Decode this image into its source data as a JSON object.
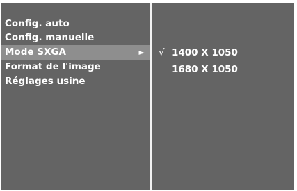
{
  "menu": {
    "items": [
      {
        "label": "Config. auto"
      },
      {
        "label": "Config. manuelle"
      },
      {
        "label": "Mode SXGA",
        "arrow": "►"
      },
      {
        "label": "Format de l'image"
      },
      {
        "label": "Réglages usine"
      }
    ]
  },
  "submenu": {
    "check_mark": "√",
    "options": [
      {
        "label": "1400 X 1050",
        "checked": true
      },
      {
        "label": "1680 X 1050",
        "checked": false
      }
    ]
  },
  "colors": {
    "panel_bg": "#646464",
    "highlight_bg": "#8e8e8e",
    "divider": "#f2f2f2",
    "text": "#ffffff"
  }
}
